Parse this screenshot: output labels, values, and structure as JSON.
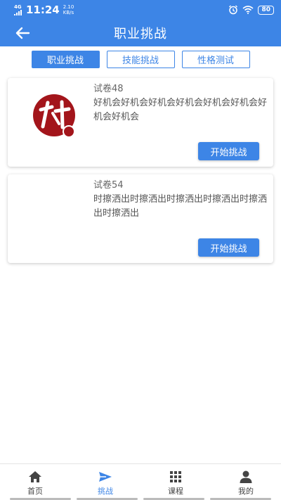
{
  "status_bar": {
    "network": "4G",
    "time": "11:24",
    "speed_value": "2.10",
    "speed_unit": "KB/s",
    "battery": "80",
    "icons": [
      "alarm-icon",
      "wifi-icon",
      "battery-icon"
    ]
  },
  "app_bar": {
    "title": "职业挑战",
    "back_icon": "back-arrow-icon"
  },
  "tabs": [
    {
      "label": "职业挑战",
      "active": true
    },
    {
      "label": "技能挑战",
      "active": false
    },
    {
      "label": "性格测试",
      "active": false
    }
  ],
  "cards": [
    {
      "name": "试卷48",
      "description": "好机会好机会好机会好机会好机会好机会好机会好机会",
      "button": "开始挑战",
      "image_icon": "logo-icon"
    },
    {
      "name": "试卷54",
      "description": "时擦洒出时擦洒出时擦洒出时擦洒出时擦洒出时擦洒出",
      "button": "开始挑战",
      "image_icon": ""
    }
  ],
  "bottom_nav": [
    {
      "label": "首页",
      "icon": "home-icon",
      "active": false
    },
    {
      "label": "挑战",
      "icon": "send-icon",
      "active": true
    },
    {
      "label": "课程",
      "icon": "grid-icon",
      "active": false
    },
    {
      "label": "我的",
      "icon": "person-icon",
      "active": false
    }
  ],
  "colors": {
    "primary": "#3d85e6",
    "logo_red": "#a3151b"
  }
}
